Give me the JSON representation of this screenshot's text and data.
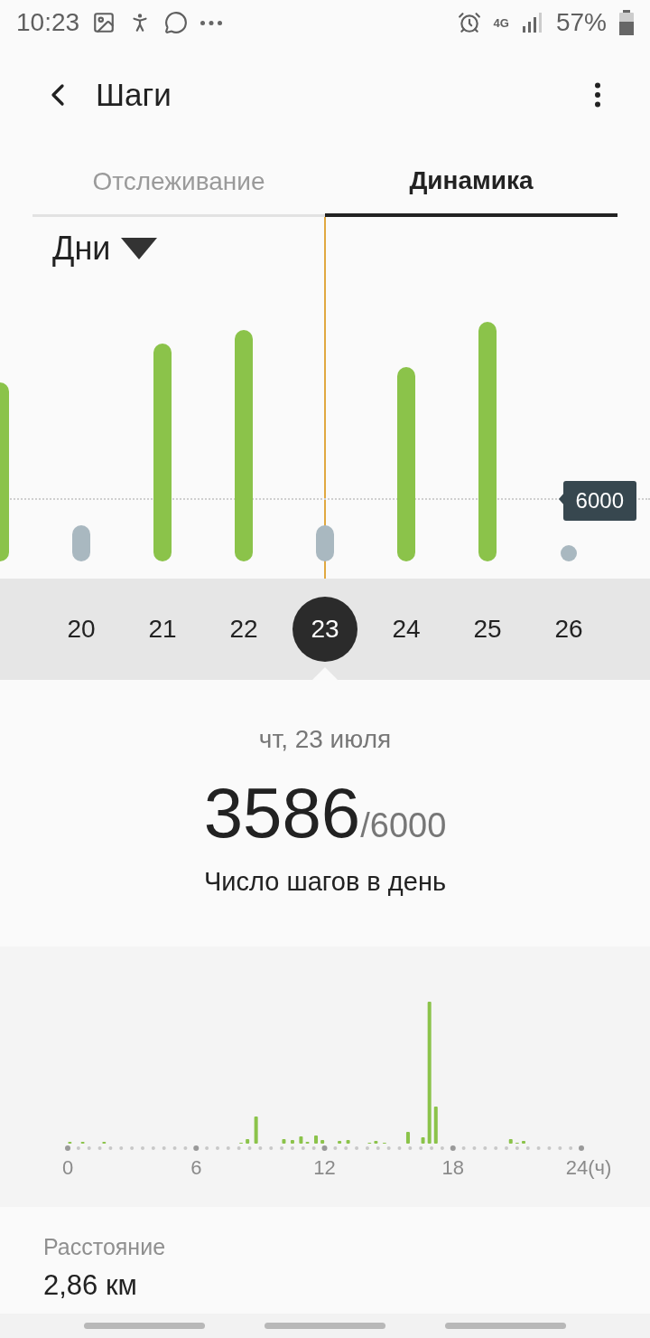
{
  "status_bar": {
    "time": "10:23",
    "network": "4G",
    "battery": "57%"
  },
  "header": {
    "title": "Шаги"
  },
  "tabs": [
    {
      "label": "Отслеживание",
      "selected": false
    },
    {
      "label": "Динамика",
      "selected": true
    }
  ],
  "period": {
    "label": "Дни"
  },
  "goal": {
    "label": "6000"
  },
  "days": [
    {
      "label": "20",
      "selected": false
    },
    {
      "label": "21",
      "selected": false
    },
    {
      "label": "22",
      "selected": false
    },
    {
      "label": "23",
      "selected": true
    },
    {
      "label": "24",
      "selected": false
    },
    {
      "label": "25",
      "selected": false
    },
    {
      "label": "26",
      "selected": false
    }
  ],
  "summary": {
    "date": "чт, 23 июля",
    "steps": "3586",
    "goal": "/6000",
    "caption": "Число шагов в день"
  },
  "hourly": {
    "axis_labels": [
      "0",
      "6",
      "12",
      "18",
      "24(ч)"
    ]
  },
  "distance": {
    "label": "Расстояние",
    "value": "2,86 км"
  }
}
